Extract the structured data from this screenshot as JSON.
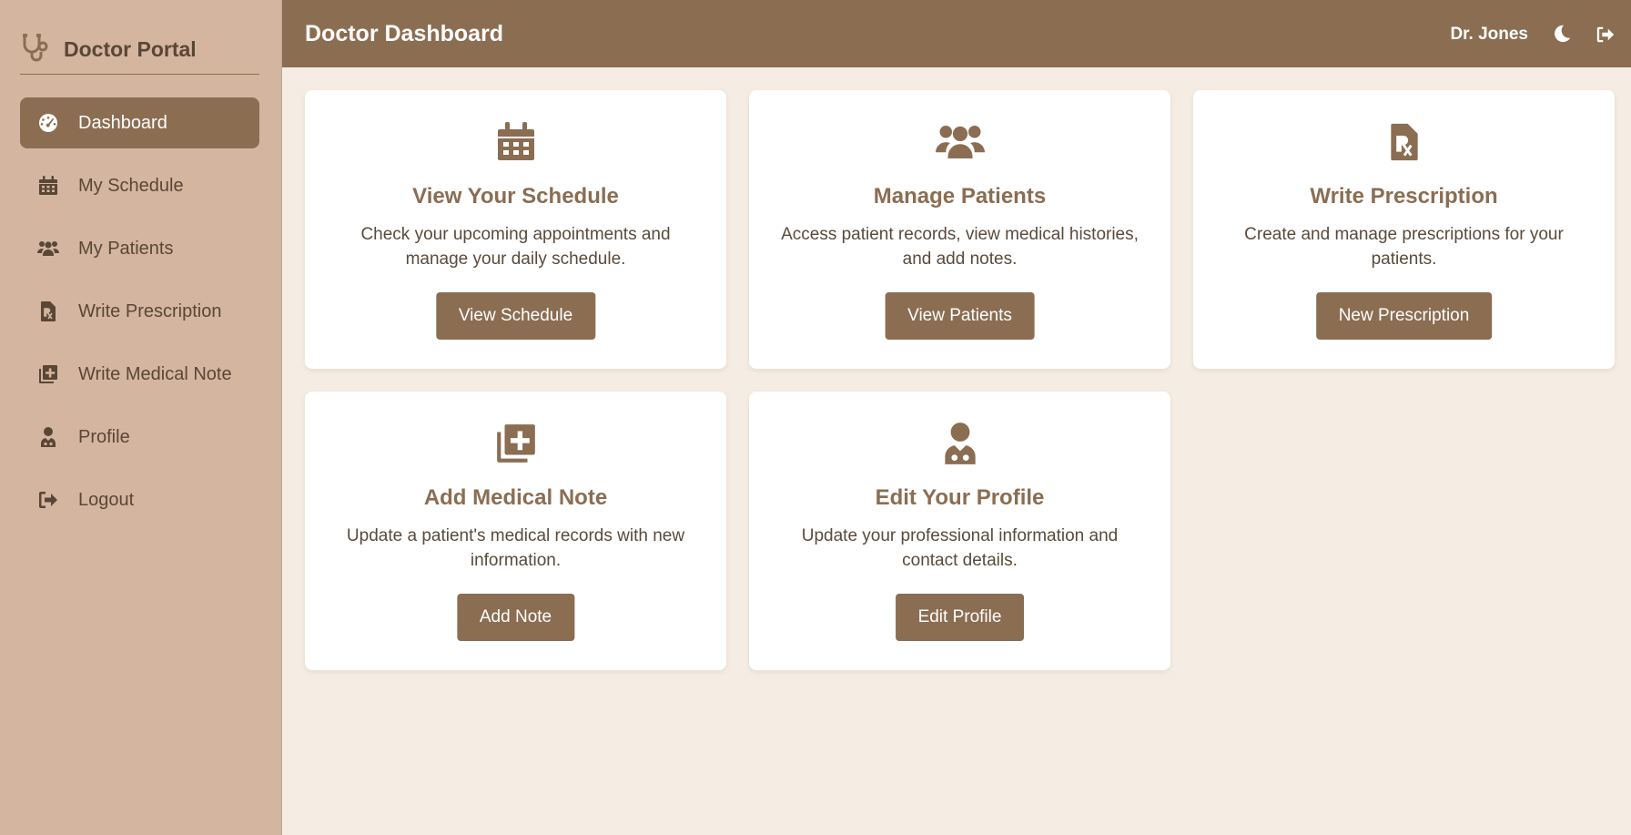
{
  "sidebar": {
    "brand": "Doctor Portal",
    "items": [
      {
        "label": "Dashboard",
        "icon": "gauge-icon",
        "active": true
      },
      {
        "label": "My Schedule",
        "icon": "calendar-icon"
      },
      {
        "label": "My Patients",
        "icon": "users-icon"
      },
      {
        "label": "Write Prescription",
        "icon": "prescription-icon"
      },
      {
        "label": "Write Medical Note",
        "icon": "note-plus-icon"
      },
      {
        "label": "Profile",
        "icon": "doctor-icon"
      },
      {
        "label": "Logout",
        "icon": "logout-icon"
      }
    ]
  },
  "header": {
    "title": "Doctor Dashboard",
    "user": "Dr. Jones"
  },
  "cards": [
    {
      "title": "View Your Schedule",
      "desc": "Check your upcoming appointments and manage your daily schedule.",
      "button": "View Schedule",
      "icon": "calendar-icon"
    },
    {
      "title": "Manage Patients",
      "desc": "Access patient records, view medical histories, and add notes.",
      "button": "View Patients",
      "icon": "users-icon"
    },
    {
      "title": "Write Prescription",
      "desc": "Create and manage prescriptions for your patients.",
      "button": "New Prescription",
      "icon": "prescription-icon"
    },
    {
      "title": "Add Medical Note",
      "desc": "Update a patient's medical records with new information.",
      "button": "Add Note",
      "icon": "note-plus-icon"
    },
    {
      "title": "Edit Your Profile",
      "desc": "Update your professional information and contact details.",
      "button": "Edit Profile",
      "icon": "doctor-icon"
    }
  ],
  "colors": {
    "primary": "#8b6d52",
    "sidebar": "#d4b6a0",
    "background": "#f5ede3",
    "card": "#ffffff"
  }
}
